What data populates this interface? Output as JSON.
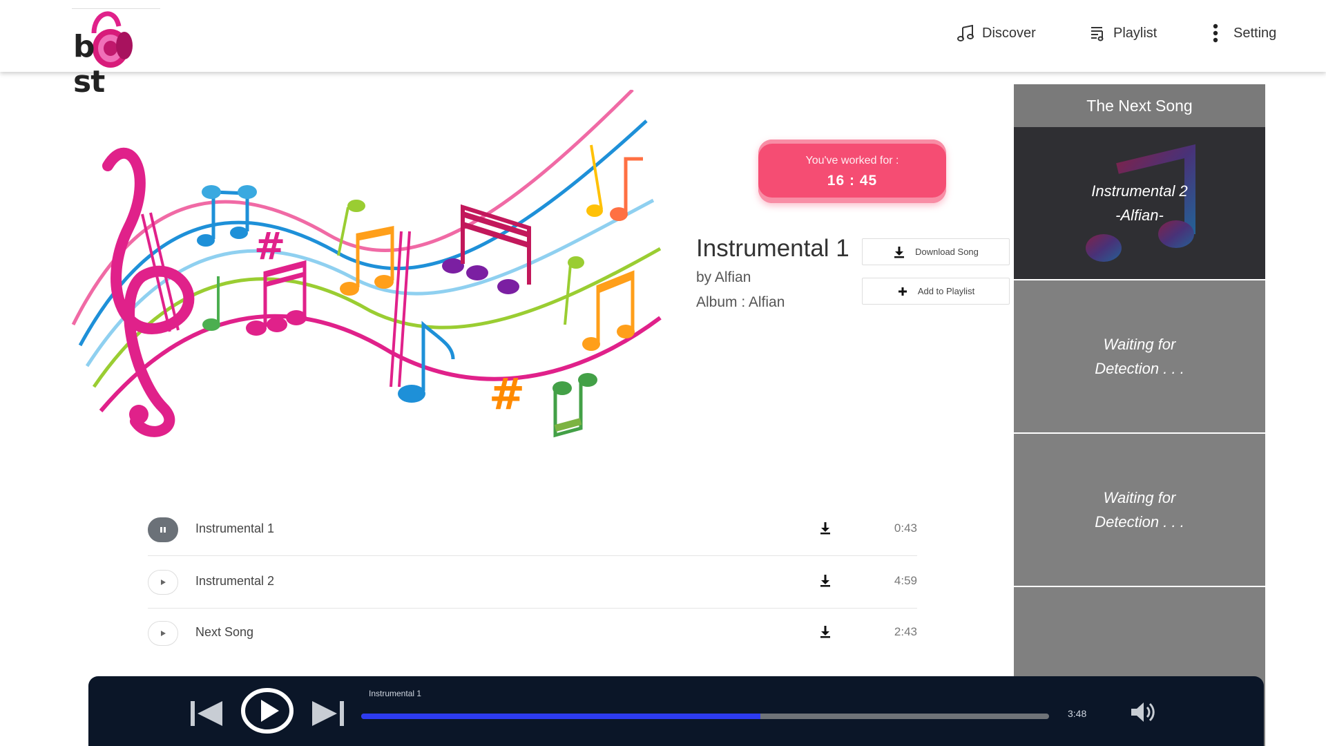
{
  "brand": {
    "logo_text_left": "b",
    "logo_text_right": "st"
  },
  "nav": {
    "discover": "Discover",
    "playlist": "Playlist",
    "setting": "Setting"
  },
  "timer": {
    "label": "You've worked for :",
    "value": "16 : 45"
  },
  "current_song": {
    "title": "Instrumental 1",
    "artist": "by Alfian",
    "album": "Album : Alfian"
  },
  "actions": {
    "download": "Download Song",
    "add_to_playlist": "Add to Playlist"
  },
  "tracks": [
    {
      "name": "Instrumental 1",
      "duration": "0:43",
      "state": "playing"
    },
    {
      "name": "Instrumental 2",
      "duration": "4:59",
      "state": "idle"
    },
    {
      "name": "Next Song",
      "duration": "2:43",
      "state": "idle"
    }
  ],
  "next_panel": {
    "title": "The Next Song",
    "cards": [
      {
        "line1": "Instrumental 2",
        "line2": "-Alfian-"
      },
      {
        "line1": "Waiting for",
        "line2": "Detection . . ."
      },
      {
        "line1": "Waiting for",
        "line2": "Detection . . ."
      }
    ]
  },
  "player": {
    "now_playing": "Instrumental 1",
    "time": "3:48",
    "progress": 0.58
  },
  "colors": {
    "accent_pink": "#f54d73",
    "player_bg": "#0b1628",
    "progress_fill": "#2d3bf0",
    "panel_gray": "#808080"
  }
}
